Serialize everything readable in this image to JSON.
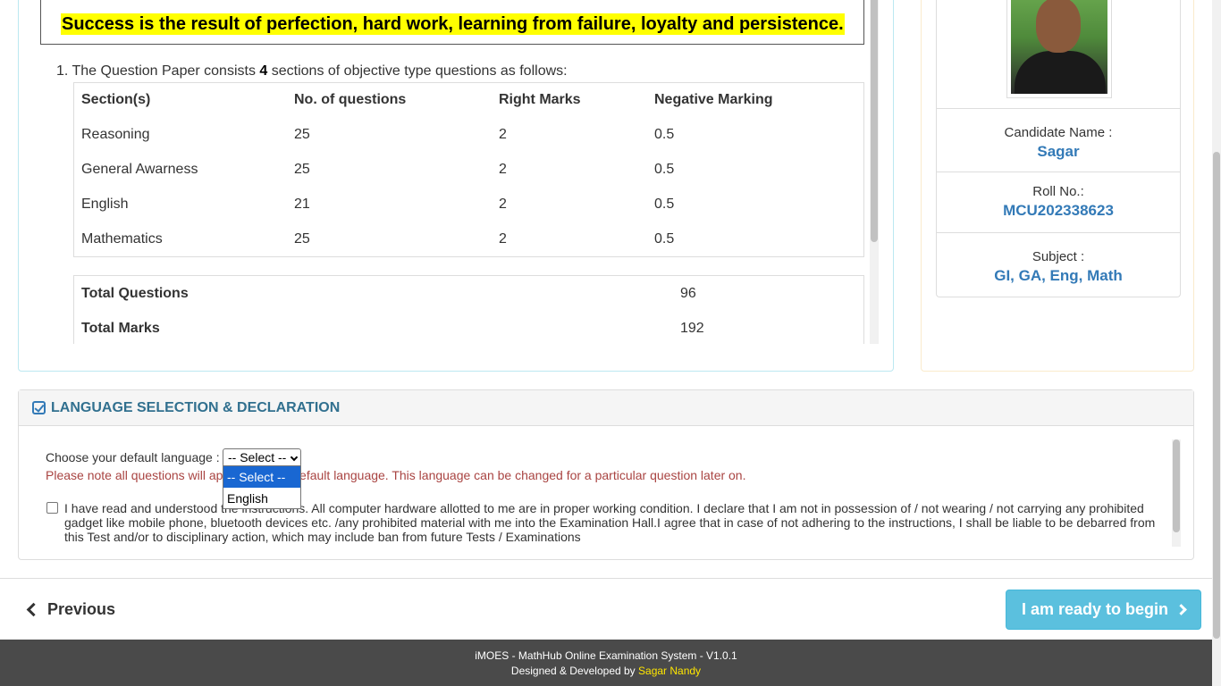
{
  "instructions": {
    "quote": "Success is the result of perfection, hard work, learning from failure, loyalty and persistence.",
    "item1_prefix": "1. The Question Paper consists ",
    "item1_count": "4",
    "item1_suffix": " sections of objective type questions as follows:",
    "table_headers": [
      "Section(s)",
      "No. of questions",
      "Right Marks",
      "Negative Marking"
    ],
    "sections": [
      {
        "name": "Reasoning",
        "questions": "25",
        "right": "2",
        "negative": "0.5"
      },
      {
        "name": "General Awarness",
        "questions": "25",
        "right": "2",
        "negative": "0.5"
      },
      {
        "name": "English",
        "questions": "21",
        "right": "2",
        "negative": "0.5"
      },
      {
        "name": "Mathematics",
        "questions": "25",
        "right": "2",
        "negative": "0.5"
      }
    ],
    "totals": [
      {
        "label": "Total Questions",
        "value": "96"
      },
      {
        "label": "Total Marks",
        "value": "192"
      }
    ]
  },
  "candidate": {
    "name_label": "Candidate Name :",
    "name": "Sagar",
    "roll_label": "Roll No.:",
    "roll": "MCU202338623",
    "subject_label": "Subject :",
    "subject": "GI, GA, Eng, Math"
  },
  "language": {
    "title": "LANGUAGE SELECTION & DECLARATION",
    "choose_label": "Choose your default language :",
    "selected": "-- Select --",
    "options": [
      "-- Select --",
      "English"
    ],
    "note": "Please note all questions will appear in your default language. This language can be changed for a particular question later on.",
    "declaration": "I have read and understood the instructions. All computer hardware allotted to me are in proper working condition. I declare that I am not in possession of / not wearing / not carrying any prohibited gadget like mobile phone, bluetooth devices etc. /any prohibited material with me into the Examination Hall.I agree that in case of not adhering to the instructions, I shall be liable to be debarred from this Test and/or to disciplinary action, which may include ban from future Tests / Examinations"
  },
  "nav": {
    "previous": "Previous",
    "begin": "I am ready to begin"
  },
  "footer": {
    "line1": "iMOES - MathHub Online Examination System - V1.0.1",
    "line2_prefix": "Designed & Developed by ",
    "author": "Sagar Nandy"
  },
  "colors": {
    "accent": "#337ab7",
    "begin_button": "#5bc0de",
    "note_text": "#a94442",
    "quote_highlight": "#ffff00",
    "footer_bg": "#4a4a4a",
    "footer_author": "#ffe600"
  }
}
